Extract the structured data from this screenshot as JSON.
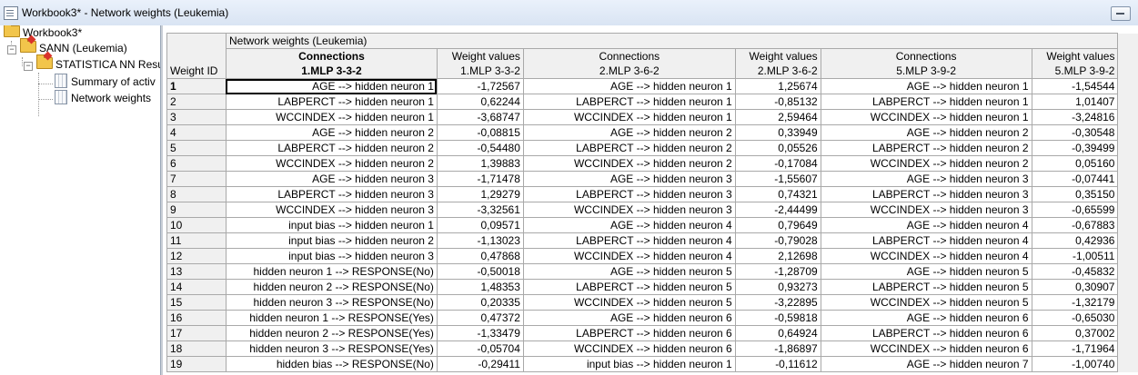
{
  "window": {
    "title": "Workbook3* - Network weights (Leukemia)"
  },
  "tree": {
    "root": "Workbook3*",
    "level1": "SANN (Leukemia)",
    "level2": "STATISTICA NN Resu",
    "leaf1": "Summary of activ",
    "leaf2": "Network weights"
  },
  "sheet": {
    "caption": "Network weights (Leukemia)",
    "corner_label": "Weight ID",
    "headers": [
      {
        "top": "Connections",
        "bottom": "1.MLP 3-3-2"
      },
      {
        "top": "Weight values",
        "bottom": "1.MLP 3-3-2"
      },
      {
        "top": "Connections",
        "bottom": "2.MLP 3-6-2"
      },
      {
        "top": "Weight values",
        "bottom": "2.MLP 3-6-2"
      },
      {
        "top": "Connections",
        "bottom": "5.MLP 3-9-2"
      },
      {
        "top": "Weight values",
        "bottom": "5.MLP 3-9-2"
      }
    ],
    "rows": [
      [
        "1",
        "AGE --> hidden neuron 1",
        "-1,72567",
        "AGE --> hidden neuron 1",
        "1,25674",
        "AGE --> hidden neuron 1",
        "-1,54544"
      ],
      [
        "2",
        "LABPERCT --> hidden neuron 1",
        "0,62244",
        "LABPERCT --> hidden neuron 1",
        "-0,85132",
        "LABPERCT --> hidden neuron 1",
        "1,01407"
      ],
      [
        "3",
        "WCCINDEX --> hidden neuron 1",
        "-3,68747",
        "WCCINDEX --> hidden neuron 1",
        "2,59464",
        "WCCINDEX --> hidden neuron 1",
        "-3,24816"
      ],
      [
        "4",
        "AGE --> hidden neuron 2",
        "-0,08815",
        "AGE --> hidden neuron 2",
        "0,33949",
        "AGE --> hidden neuron 2",
        "-0,30548"
      ],
      [
        "5",
        "LABPERCT --> hidden neuron 2",
        "-0,54480",
        "LABPERCT --> hidden neuron 2",
        "0,05526",
        "LABPERCT --> hidden neuron 2",
        "-0,39499"
      ],
      [
        "6",
        "WCCINDEX --> hidden neuron 2",
        "1,39883",
        "WCCINDEX --> hidden neuron 2",
        "-0,17084",
        "WCCINDEX --> hidden neuron 2",
        "0,05160"
      ],
      [
        "7",
        "AGE --> hidden neuron 3",
        "-1,71478",
        "AGE --> hidden neuron 3",
        "-1,55607",
        "AGE --> hidden neuron 3",
        "-0,07441"
      ],
      [
        "8",
        "LABPERCT --> hidden neuron 3",
        "1,29279",
        "LABPERCT --> hidden neuron 3",
        "0,74321",
        "LABPERCT --> hidden neuron 3",
        "0,35150"
      ],
      [
        "9",
        "WCCINDEX --> hidden neuron 3",
        "-3,32561",
        "WCCINDEX --> hidden neuron 3",
        "-2,44499",
        "WCCINDEX --> hidden neuron 3",
        "-0,65599"
      ],
      [
        "10",
        "input bias --> hidden neuron 1",
        "0,09571",
        "AGE --> hidden neuron 4",
        "0,79649",
        "AGE --> hidden neuron 4",
        "-0,67883"
      ],
      [
        "11",
        "input bias --> hidden neuron 2",
        "-1,13023",
        "LABPERCT --> hidden neuron 4",
        "-0,79028",
        "LABPERCT --> hidden neuron 4",
        "0,42936"
      ],
      [
        "12",
        "input bias --> hidden neuron 3",
        "0,47868",
        "WCCINDEX --> hidden neuron 4",
        "2,12698",
        "WCCINDEX --> hidden neuron 4",
        "-1,00511"
      ],
      [
        "13",
        "hidden neuron 1 --> RESPONSE(No)",
        "-0,50018",
        "AGE --> hidden neuron 5",
        "-1,28709",
        "AGE --> hidden neuron 5",
        "-0,45832"
      ],
      [
        "14",
        "hidden neuron 2 --> RESPONSE(No)",
        "1,48353",
        "LABPERCT --> hidden neuron 5",
        "0,93273",
        "LABPERCT --> hidden neuron 5",
        "0,30907"
      ],
      [
        "15",
        "hidden neuron 3 --> RESPONSE(No)",
        "0,20335",
        "WCCINDEX --> hidden neuron 5",
        "-3,22895",
        "WCCINDEX --> hidden neuron 5",
        "-1,32179"
      ],
      [
        "16",
        "hidden neuron 1 --> RESPONSE(Yes)",
        "0,47372",
        "AGE --> hidden neuron 6",
        "-0,59818",
        "AGE --> hidden neuron 6",
        "-0,65030"
      ],
      [
        "17",
        "hidden neuron 2 --> RESPONSE(Yes)",
        "-1,33479",
        "LABPERCT --> hidden neuron 6",
        "0,64924",
        "LABPERCT --> hidden neuron 6",
        "0,37002"
      ],
      [
        "18",
        "hidden neuron 3 --> RESPONSE(Yes)",
        "-0,05704",
        "WCCINDEX --> hidden neuron 6",
        "-1,86897",
        "WCCINDEX --> hidden neuron 6",
        "-1,71964"
      ],
      [
        "19",
        "hidden bias --> RESPONSE(No)",
        "-0,29411",
        "input bias --> hidden neuron 1",
        "-0,11612",
        "AGE --> hidden neuron 7",
        "-1,00740"
      ]
    ]
  }
}
